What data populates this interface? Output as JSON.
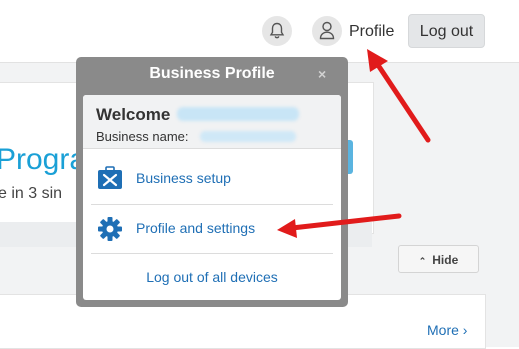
{
  "header": {
    "profile_label": "Profile",
    "logout_label": "Log out",
    "bell_icon": "bell-icon",
    "user_icon": "user-icon"
  },
  "background": {
    "program_text": "Progra",
    "sub_text": "e in 3 sin",
    "hide_label": "Hide",
    "more_label": "More"
  },
  "popup": {
    "title": "Business Profile",
    "close_glyph": "×",
    "welcome_label": "Welcome",
    "business_name_label": "Business name:",
    "items": [
      {
        "label": "Business setup",
        "icon": "business-setup-icon"
      },
      {
        "label": "Profile and settings",
        "icon": "gear-icon"
      }
    ],
    "logout_all_label": "Log out of all devices"
  },
  "colors": {
    "link": "#1f6fb5",
    "popup_frame": "#8a8a8a",
    "arrow": "#e11b1b",
    "accent_blue": "#1aa0d6"
  }
}
